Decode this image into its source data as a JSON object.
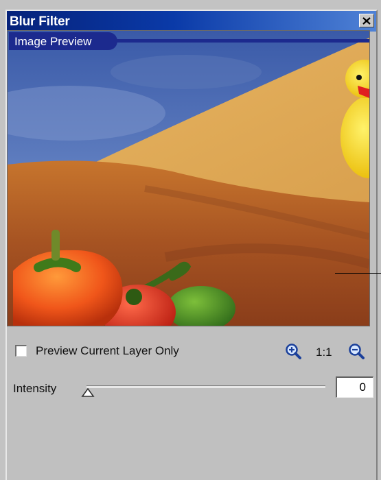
{
  "window": {
    "title": "Blur Filter",
    "close_icon": "close-icon"
  },
  "preview": {
    "label": "Image Preview",
    "accent_color": "#1c2a8e"
  },
  "options": {
    "preview_current_layer_only_label": "Preview Current Layer Only",
    "preview_current_layer_only_checked": false
  },
  "zoom": {
    "zoom_in_icon": "zoom-in-icon",
    "actual_size_label": "1:1",
    "zoom_out_icon": "zoom-out-icon"
  },
  "intensity": {
    "label": "Intensity",
    "value": "0"
  }
}
